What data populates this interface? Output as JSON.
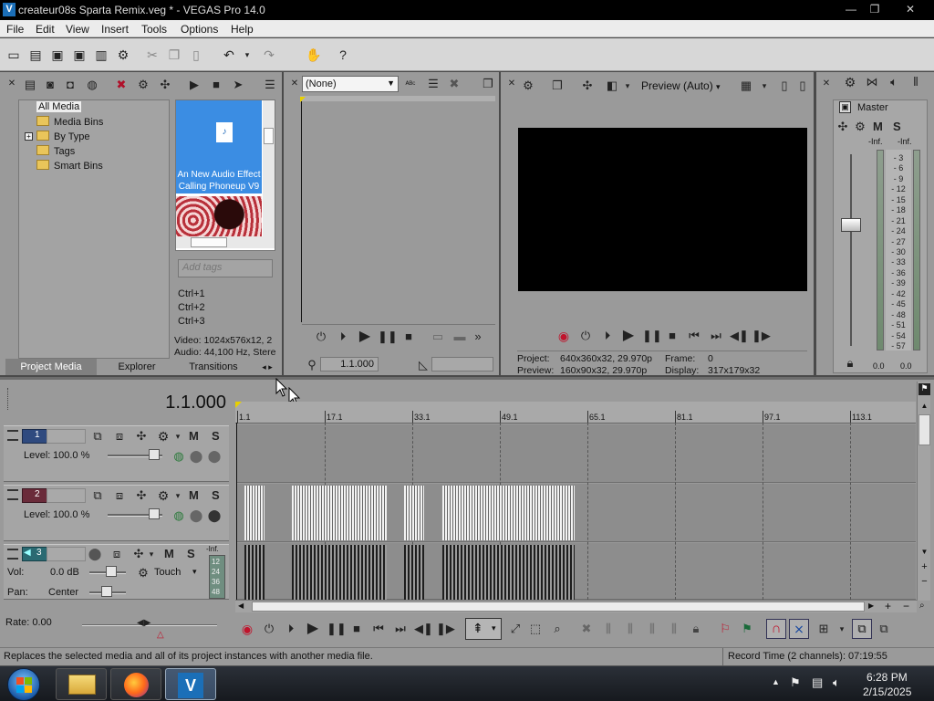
{
  "window": {
    "title": "createur08s Sparta Remix.veg * - VEGAS Pro 14.0",
    "logo_letter": "V"
  },
  "menu": [
    "File",
    "Edit",
    "View",
    "Insert",
    "Tools",
    "Options",
    "Help"
  ],
  "media_tree": [
    "All Media",
    "Media Bins",
    "By Type",
    "Tags",
    "Smart Bins"
  ],
  "thumb": {
    "label": "An New Audio Effect Calling Phoneup V9"
  },
  "tags": {
    "placeholder": "Add tags",
    "shortcuts": [
      "Ctrl+1",
      "Ctrl+2",
      "Ctrl+3"
    ]
  },
  "media_info": {
    "video": "Video: 1024x576x12, 2",
    "audio": "Audio: 44,100 Hz, Stere"
  },
  "tabs": [
    "Project Media",
    "Explorer",
    "Transitions"
  ],
  "trimmer": {
    "selector": "(None)",
    "time": "1.1.000"
  },
  "preview": {
    "mode": "Preview (Auto)",
    "project_label": "Project:",
    "project": "640x360x32, 29.970p",
    "preview_label": "Preview:",
    "preview": "160x90x32, 29.970p",
    "frame_label": "Frame:",
    "frame": "0",
    "display_label": "Display:",
    "display": "317x179x32"
  },
  "mixer": {
    "master": "Master",
    "m": "M",
    "s": "S",
    "inf": "-Inf.",
    "scale": [
      "3",
      "6",
      "9",
      "12",
      "15",
      "18",
      "21",
      "24",
      "27",
      "30",
      "33",
      "36",
      "39",
      "42",
      "45",
      "48",
      "51",
      "54",
      "57"
    ],
    "readout_l": "0.0",
    "readout_r": "0.0"
  },
  "timeline": {
    "time": "1.1.000",
    "ruler": [
      "1.1",
      "17.1",
      "33.1",
      "49.1",
      "65.1",
      "81.1",
      "97.1",
      "113.1"
    ]
  },
  "tracks": [
    {
      "num": "1",
      "level_label": "Level:",
      "level": "100.0 %",
      "m": "M",
      "s": "S"
    },
    {
      "num": "2",
      "level_label": "Level:",
      "level": "100.0 %",
      "m": "M",
      "s": "S"
    },
    {
      "num": "3",
      "vol_label": "Vol:",
      "vol": "0.0 dB",
      "pan_label": "Pan:",
      "pan": "Center",
      "mode": "Touch",
      "m": "M",
      "s": "S",
      "inf": "-Inf.",
      "meter": [
        "12",
        "24",
        "36",
        "48"
      ]
    }
  ],
  "rate": "Rate: 0.00",
  "status": {
    "message": "Replaces the selected media and all of its project instances with another media file.",
    "record": "Record Time (2 channels): 07:19:55"
  },
  "clock": {
    "time": "6:28 PM",
    "date": "2/15/2025"
  },
  "colors": {
    "track1": "#2f4a7f",
    "track2": "#6a2b3a",
    "track3": "#2b6a72",
    "record": "#c0142c"
  }
}
